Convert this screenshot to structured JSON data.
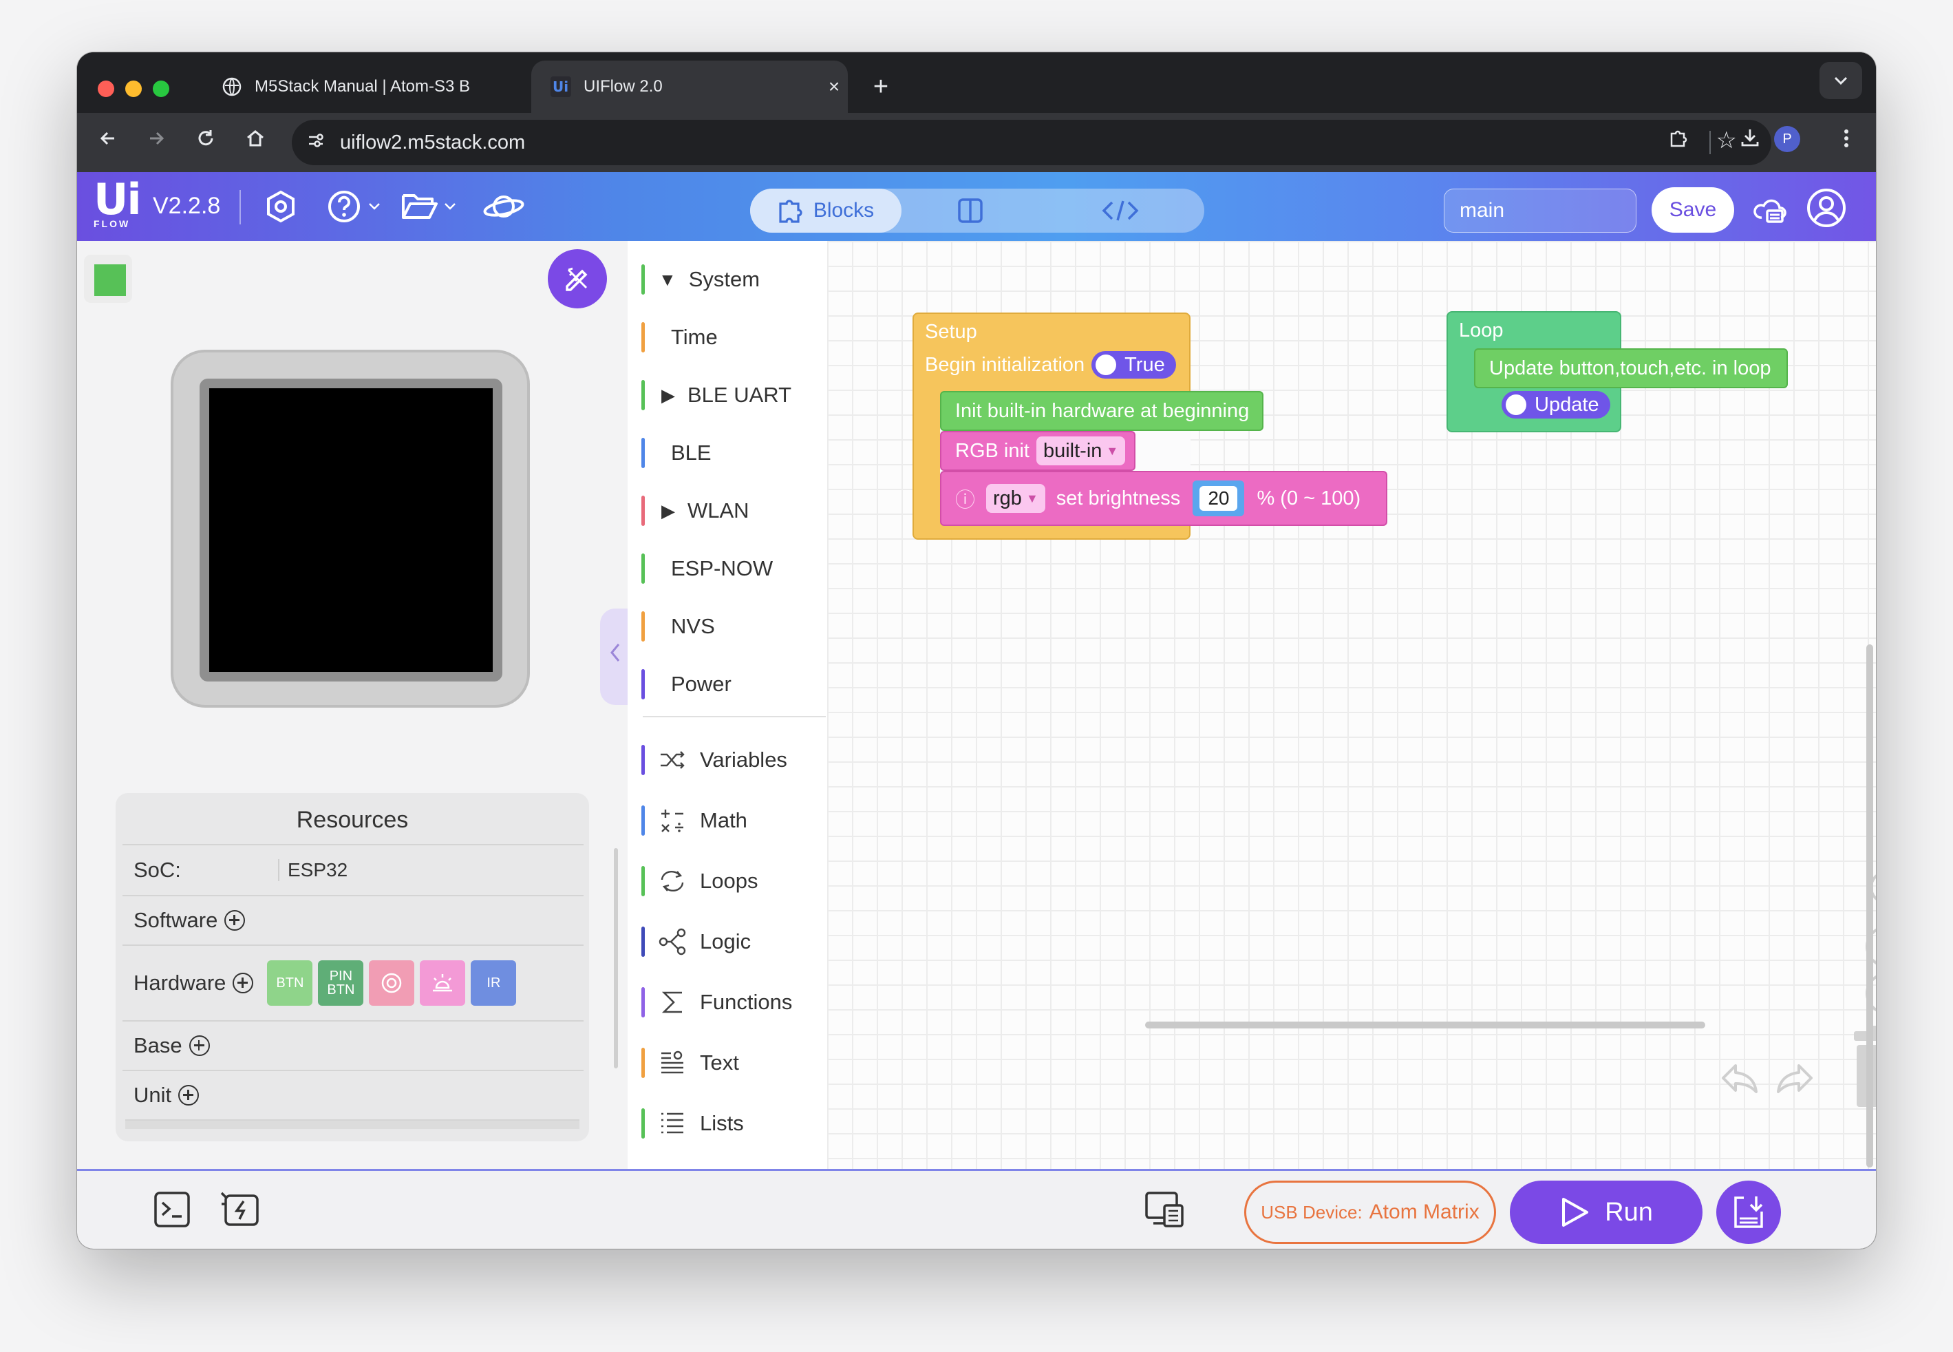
{
  "browser": {
    "tabs": [
      {
        "title": "M5Stack Manual | Atom-S3 B",
        "close": "×"
      },
      {
        "title": "UIFlow 2.0",
        "close": "×"
      }
    ],
    "new_tab": "+",
    "url": "uiflow2.m5stack.com",
    "profile_initial": "P"
  },
  "app": {
    "logo_main": "Ui",
    "logo_sub": "FLOW",
    "version": "V2.2.8",
    "modes": {
      "blocks": "Blocks"
    },
    "file_name": "main",
    "save_label": "Save"
  },
  "resources": {
    "title": "Resources",
    "soc_label": "SoC:",
    "soc_value": "ESP32",
    "software_label": "Software",
    "hardware_label": "Hardware",
    "base_label": "Base",
    "unit_label": "Unit",
    "hardware_chips": [
      {
        "label": "BTN",
        "color": "#8fd48a"
      },
      {
        "label": "PIN BTN",
        "color": "#5fae77"
      },
      {
        "label": "",
        "color": "#f19db4"
      },
      {
        "label": "",
        "color": "#f39ad6"
      },
      {
        "label": "IR",
        "color": "#6f8ee0"
      }
    ]
  },
  "categories": {
    "system": [
      {
        "label": "System",
        "color": "#57c157",
        "arrow": "▼"
      },
      {
        "label": "Time",
        "color": "#f0a040",
        "arrow": ""
      },
      {
        "label": "BLE UART",
        "color": "#57c157",
        "arrow": "▶"
      },
      {
        "label": "BLE",
        "color": "#4f86e8",
        "arrow": ""
      },
      {
        "label": "WLAN",
        "color": "#e86a7a",
        "arrow": "▶"
      },
      {
        "label": "ESP-NOW",
        "color": "#57c157",
        "arrow": ""
      },
      {
        "label": "NVS",
        "color": "#f0a040",
        "arrow": ""
      },
      {
        "label": "Power",
        "color": "#6a4fe0",
        "arrow": ""
      }
    ],
    "core": [
      {
        "label": "Variables",
        "color": "#6a4fe0",
        "icon": "shuffle-icon"
      },
      {
        "label": "Math",
        "color": "#4f86e8",
        "icon": "math-operators-icon"
      },
      {
        "label": "Loops",
        "color": "#57c157",
        "icon": "loop-arrows-icon"
      },
      {
        "label": "Logic",
        "color": "#3f4ab8",
        "icon": "logic-nodes-icon"
      },
      {
        "label": "Functions",
        "color": "#8f62e6",
        "icon": "sigma-icon"
      },
      {
        "label": "Text",
        "color": "#f0a040",
        "icon": "text-lines-icon"
      },
      {
        "label": "Lists",
        "color": "#57c157",
        "icon": "list-icon"
      }
    ]
  },
  "blocks": {
    "setup": {
      "label": "Setup",
      "begin_label": "Begin initialization",
      "begin_toggle": "True",
      "init_hw": "Init built-in hardware at beginning",
      "rgb_init_label": "RGB init",
      "rgb_init_value": "built-in",
      "info_glyph": "ⓘ",
      "rgb_var": "rgb",
      "set_brightness": "set brightness",
      "brightness_value": "20",
      "brightness_range": "% (0 ~ 100)"
    },
    "loop": {
      "label": "Loop",
      "update_label": "Update button,touch,etc. in loop",
      "update_toggle": "Update"
    }
  },
  "bottom": {
    "usb_prefix": "USB Device:",
    "usb_device": "Atom Matrix",
    "run_label": "Run"
  },
  "colors": {
    "accent": "#7b49e6",
    "setup_block": "#f6c55c",
    "loop_block": "#5dcf8a",
    "hw_block": "#6fcf64",
    "rgb_block": "#ec6bc3",
    "usb_border": "#e8743f"
  }
}
